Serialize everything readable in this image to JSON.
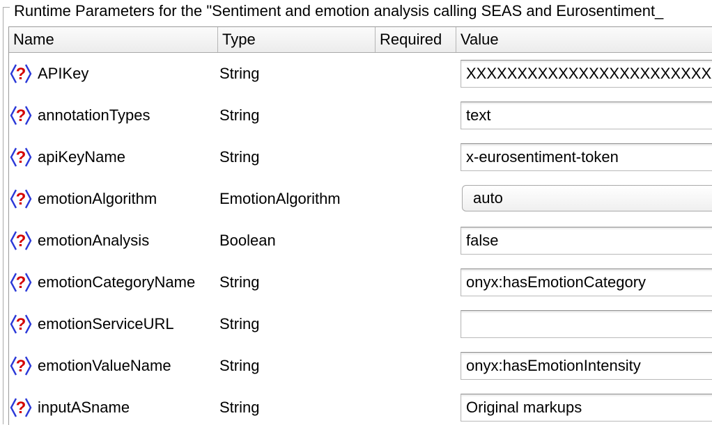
{
  "window": {
    "title": "Runtime Parameters for the \"Sentiment and emotion analysis calling SEAS and Eurosentiment_"
  },
  "table": {
    "headers": {
      "name": "Name",
      "type": "Type",
      "required": "Required",
      "value": "Value"
    },
    "rows": [
      {
        "name": "APIKey",
        "type": "String",
        "value": "XXXXXXXXXXXXXXXXXXXXXXXXXXXXXXXX",
        "control": "text"
      },
      {
        "name": "annotationTypes",
        "type": "String",
        "value": "text",
        "control": "text"
      },
      {
        "name": "apiKeyName",
        "type": "String",
        "value": "x-eurosentiment-token",
        "control": "text"
      },
      {
        "name": "emotionAlgorithm",
        "type": "EmotionAlgorithm",
        "value": "auto",
        "control": "select"
      },
      {
        "name": "emotionAnalysis",
        "type": "Boolean",
        "value": "false",
        "control": "text"
      },
      {
        "name": "emotionCategoryName",
        "type": "String",
        "value": "onyx:hasEmotionCategory",
        "control": "text"
      },
      {
        "name": "emotionServiceURL",
        "type": "String",
        "value": "",
        "control": "text"
      },
      {
        "name": "emotionValueName",
        "type": "String",
        "value": "onyx:hasEmotionIntensity",
        "control": "text"
      },
      {
        "name": "inputASname",
        "type": "String",
        "value": "Original markups",
        "control": "text"
      }
    ]
  },
  "icons": {
    "parameter": "help-question-icon"
  },
  "colors": {
    "icon_question": "#d40000",
    "icon_bracket": "#2a38d8"
  }
}
